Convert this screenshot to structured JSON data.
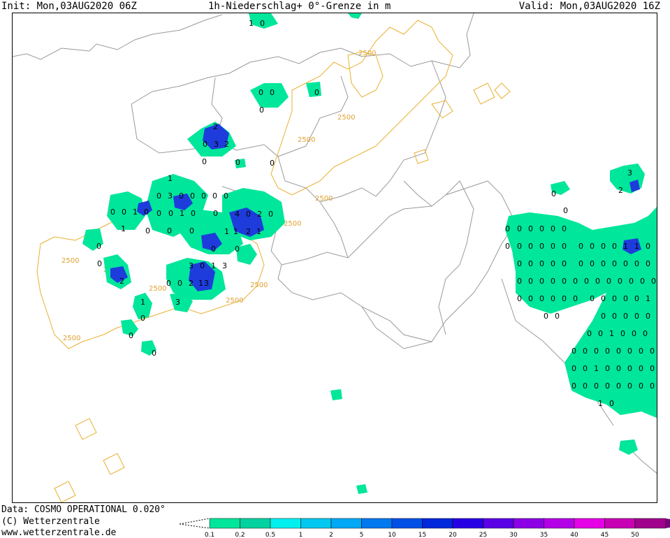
{
  "header": {
    "init": "Init: Mon,03AUG2020 06Z",
    "title": "1h-Niederschlag+ 0°-Grenze in m",
    "valid": "Valid: Mon,03AUG2020 16Z"
  },
  "footer": {
    "data_source": "Data: COSMO OPERATIONAL 0.020°",
    "copyright": "(C) Wetterzentrale",
    "url": "www.wetterzentrale.de"
  },
  "legend": {
    "values": [
      "0.1",
      "0.2",
      "0.5",
      "1",
      "2",
      "5",
      "10",
      "15",
      "20",
      "25",
      "30",
      "35",
      "40",
      "45",
      "50"
    ],
    "colors": [
      "#00e69a",
      "#00d2a0",
      "#00f0f0",
      "#00c8f0",
      "#00a8f5",
      "#0078f0",
      "#0050e6",
      "#0028dc",
      "#2800e6",
      "#5a00e6",
      "#8c00e6",
      "#b400e6",
      "#e600e6",
      "#c800b4",
      "#a0008c",
      "#780078"
    ]
  },
  "map_labels": {
    "contour_value": "2500",
    "precip_values": [
      "0",
      "1",
      "2",
      "3",
      "4"
    ]
  },
  "colors": {
    "contour": "#e8b030",
    "border": "#999999",
    "light_precip": "#00e69a",
    "heavy_precip": "#1e3cdc"
  }
}
